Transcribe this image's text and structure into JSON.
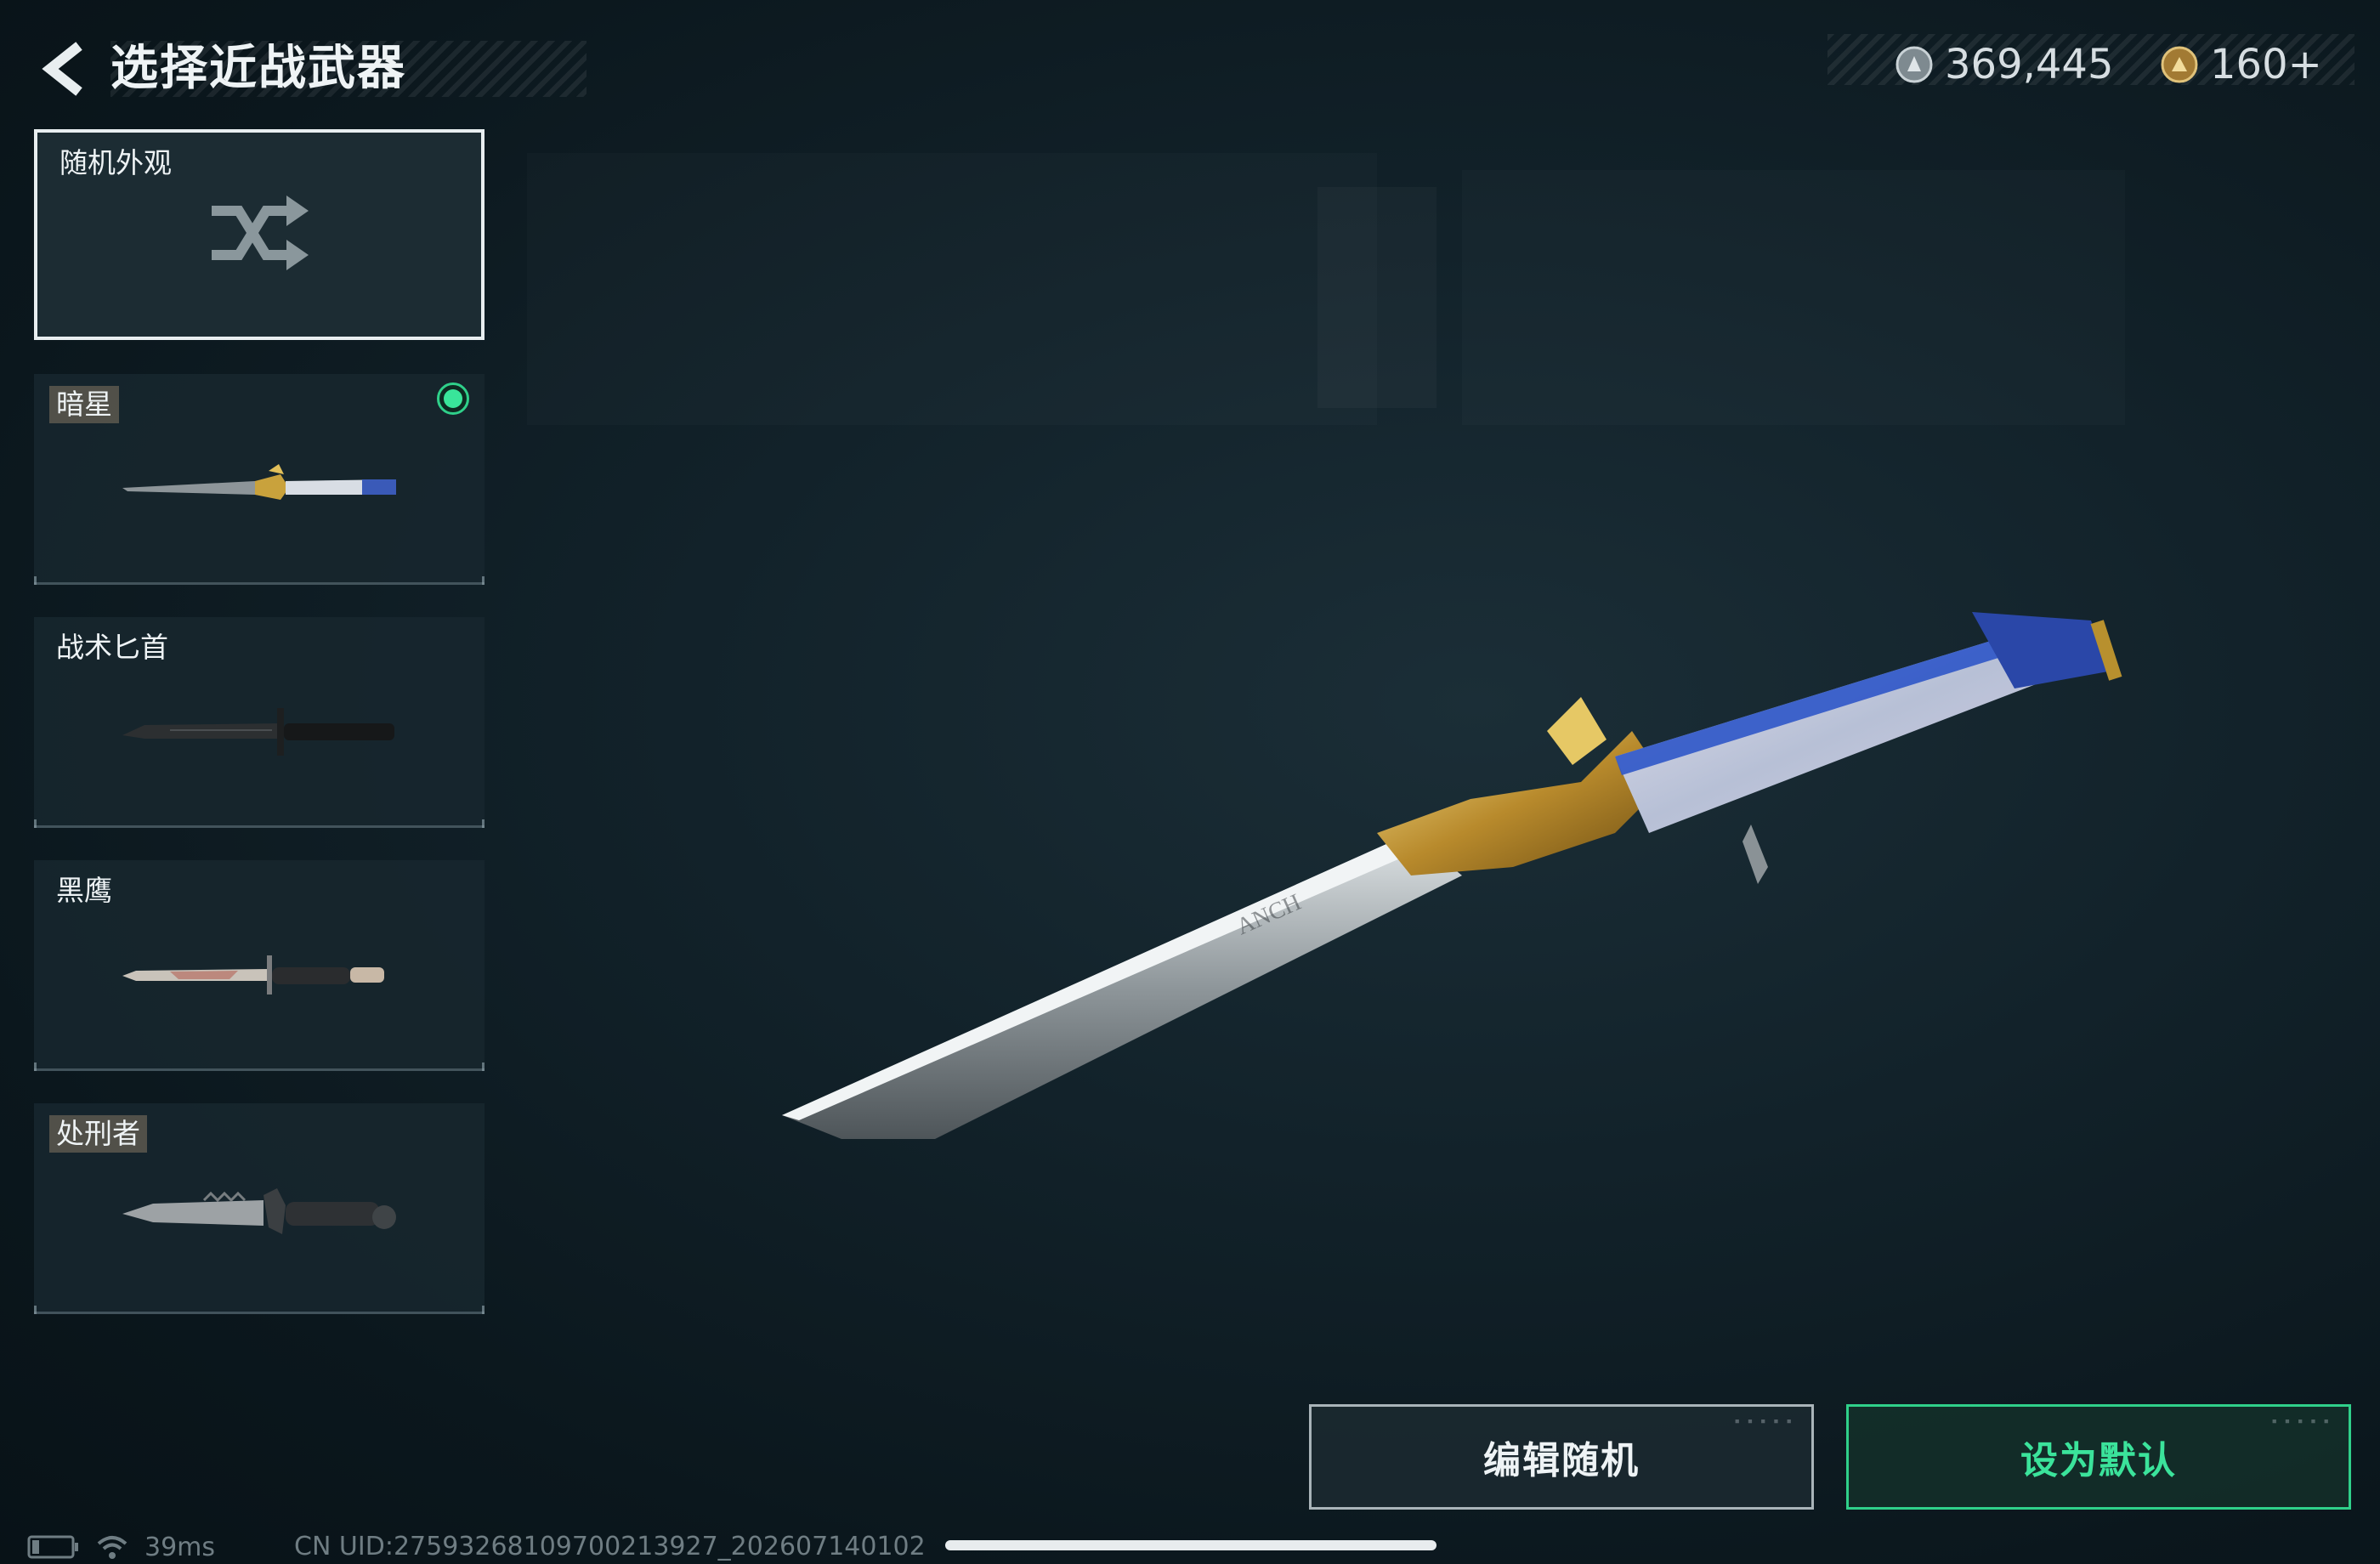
{
  "header": {
    "title": "选择近战武器",
    "back_icon": "chevron-left-icon"
  },
  "currency": [
    {
      "icon": "silver-credits-icon",
      "value": "369,445",
      "color": "#9aa4a9"
    },
    {
      "icon": "gold-points-icon",
      "value": "160+",
      "color": "#c9a45a"
    }
  ],
  "melee_list": [
    {
      "label": "随机外观",
      "icon": "shuffle-icon",
      "selected": true,
      "tagged": false,
      "equipped": false
    },
    {
      "label": "暗星",
      "tagged": true,
      "equipped": true
    },
    {
      "label": "战术匕首",
      "tagged": false,
      "equipped": false
    },
    {
      "label": "黑鹰",
      "tagged": false,
      "equipped": false
    },
    {
      "label": "处刑者",
      "tagged": true,
      "equipped": false
    }
  ],
  "preview": {
    "engraving": "ANCH"
  },
  "buttons": {
    "edit_random": "编辑随机",
    "set_default": "设为默认"
  },
  "status_bar": {
    "latency": "39ms",
    "uid": "CN UID:2759326810970021392​7_202607140102"
  },
  "colors": {
    "accent_green": "#2fd08a",
    "background": "#0f1e25"
  }
}
